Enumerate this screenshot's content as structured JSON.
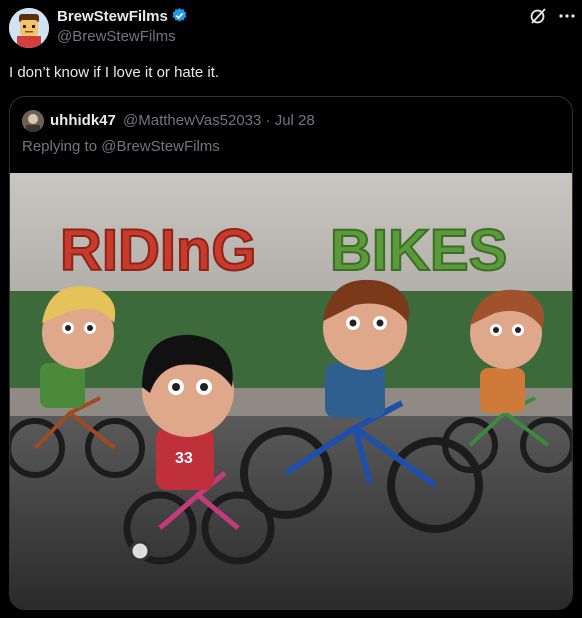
{
  "author": {
    "name": "BrewStewFilms",
    "handle": "@BrewStewFilms"
  },
  "post": {
    "text": "I don’t know if I love it or hate it."
  },
  "quoted": {
    "name": "uhhidk47",
    "handle": "@MatthewVas52033 · Jul 28",
    "reply_text": "Replying to @BrewStewFilms",
    "image": {
      "sign_word_1": "RIDInG",
      "sign_word_2": "BIKES",
      "jersey_number": "33"
    }
  },
  "colors": {
    "verified": "#1d9bf0",
    "muted": "#71767b"
  },
  "icons": [
    "verified-badge-icon",
    "grok-icon",
    "more-icon"
  ]
}
